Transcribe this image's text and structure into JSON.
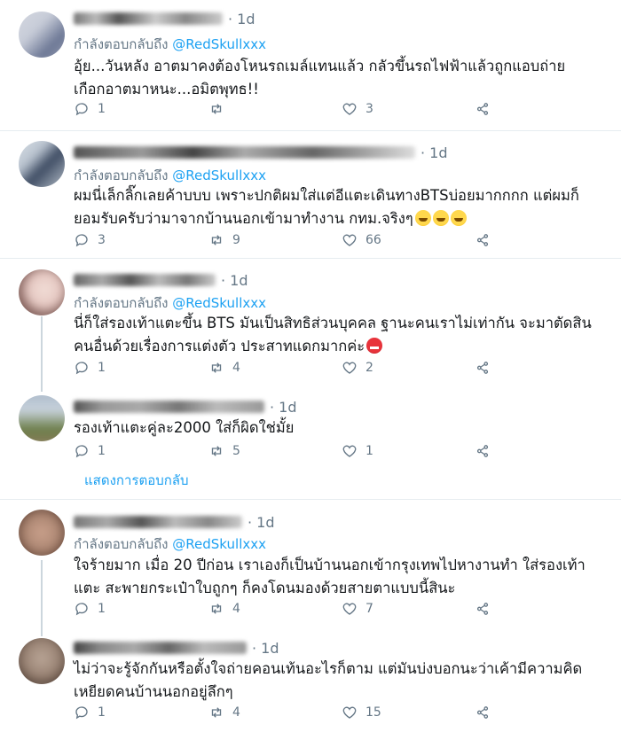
{
  "tweets": [
    {
      "time": "· 1d",
      "replying_prefix": "กำลังตอบกลับถึง",
      "handle": "@RedSkullxxx",
      "text_lines": [
        "อุ้ย...วันหลัง อาตมาคงต้องโหนรถเมล์แทนแล้ว กลัวขึ้นรถไฟฟ้าแล้วถูกแอบถ่าย",
        "เกือกอาตมาหนะ...อมิตพุทธ!!"
      ],
      "reply_count": "1",
      "retweet_count": "",
      "like_count": "3",
      "avatar_colors": [
        "#c7ccd8",
        "#6b7694"
      ]
    },
    {
      "time": "· 1d",
      "replying_prefix": "กำลังตอบกลับถึง",
      "handle": "@RedSkullxxx",
      "text_lines": [
        "ผมนี่เล็กลิ๊กเลยค้าบบบ เพราะปกติผมใส่แต่อีแตะเดินทางBTSบ่อยมากกกก แต่ผมก็",
        "ยอมรับครับว่ามาจากบ้านนอกเข้ามาทำงาน กทม.จริงๆ"
      ],
      "reply_count": "3",
      "retweet_count": "9",
      "like_count": "66",
      "avatar_colors": [
        "#b9c3cf",
        "#3e4c63"
      ]
    },
    {
      "time": "· 1d",
      "replying_prefix": "กำลังตอบกลับถึง",
      "handle": "@RedSkullxxx",
      "text_lines": [
        "นี่ก็ใส่รองเท้าแตะขึ้น BTS มันเป็นสิทธิส่วนบุคคล ฐานะคนเราไม่เท่ากัน จะมาตัดสิน",
        "คนอื่นด้วยเรื่องการแต่งตัว ประสาทแดกมากค่ะ"
      ],
      "reply_count": "1",
      "retweet_count": "4",
      "like_count": "2",
      "avatar_colors": [
        "#e6c9c3",
        "#7d5a55"
      ]
    },
    {
      "time": "· 1d",
      "text_lines": [
        "รองเท้าแตะคู่ละ2000 ใส่ก็ผิดใช่มั้ย"
      ],
      "reply_count": "1",
      "retweet_count": "5",
      "like_count": "1",
      "avatar_colors": [
        "#a9b8c9",
        "#6d7f4b"
      ]
    },
    {
      "time": "· 1d",
      "replying_prefix": "กำลังตอบกลับถึง",
      "handle": "@RedSkullxxx",
      "text_lines": [
        "ใจร้ายมาก เมื่อ 20 ปีก่อน เราเองก็เป็นบ้านนอกเข้ากรุงเทพไปหางานทำ ใส่รองเท้า",
        "แตะ สะพายกระเป๋าใบถูกๆ ก็คงโดนมองด้วยสายตาแบบนี้สินะ"
      ],
      "reply_count": "1",
      "retweet_count": "4",
      "like_count": "7",
      "avatar_colors": [
        "#b08a76",
        "#5e4033"
      ]
    },
    {
      "time": "· 1d",
      "text_lines": [
        "ไม่ว่าจะรู้จักกันหรือตั้งใจถ่ายคอนเท้นอะไรก็ตาม แต่มันบ่งบอกนะว่าเค้ามีความคิด",
        "เหยียดคนบ้านนอกอยู่ลึกๆ"
      ],
      "reply_count": "1",
      "retweet_count": "4",
      "like_count": "15",
      "avatar_colors": [
        "#9c8677",
        "#4f3d33"
      ]
    }
  ],
  "show_replies": "แสดงการตอบกลับ",
  "colors": {
    "accent": "#1da1f2",
    "muted": "#657786",
    "divider": "#e6ecf0"
  },
  "icons": [
    "reply-icon",
    "retweet-icon",
    "like-icon",
    "share-icon"
  ]
}
